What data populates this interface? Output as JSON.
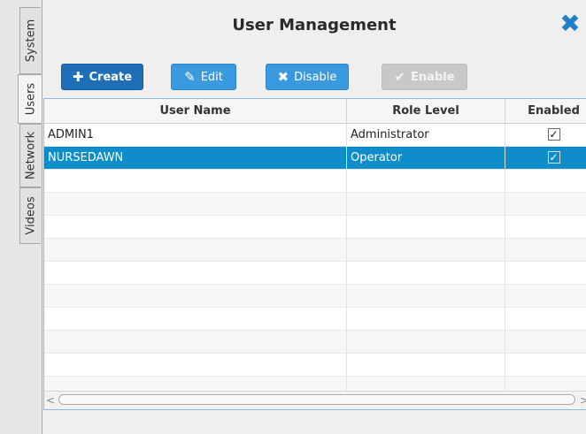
{
  "tabs": [
    {
      "label": "System"
    },
    {
      "label": "Users"
    },
    {
      "label": "Network"
    },
    {
      "label": "Videos"
    }
  ],
  "active_tab": "Users",
  "title": "User Management",
  "toolbar": {
    "create_label": "Create",
    "edit_label": "Edit",
    "disable_label": "Disable",
    "enable_label": "Enable"
  },
  "table": {
    "columns": [
      "User Name",
      "Role Level",
      "Enabled"
    ],
    "rows": [
      {
        "user": "ADMIN1",
        "role": "Administrator",
        "enabled": "✓",
        "selected": false
      },
      {
        "user": "NURSEDAWN",
        "role": "Operator",
        "enabled": "✓",
        "selected": true
      }
    ],
    "empty_rows": 10
  },
  "colors": {
    "accent": "#1e6fb8",
    "button": "#3a9ae0",
    "selection": "#0f8dcb",
    "close_icon": "#1f7fc7"
  },
  "icons": {
    "close": "close-icon",
    "create": "plus-icon",
    "edit": "pencil-icon",
    "disable": "x-icon",
    "enable": "check-icon"
  }
}
